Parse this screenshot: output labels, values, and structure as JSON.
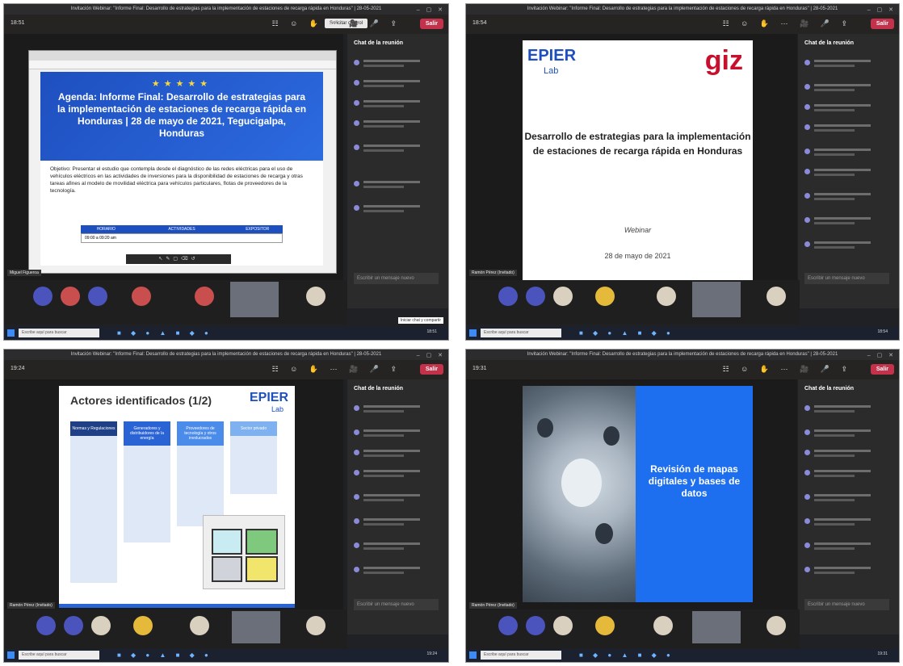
{
  "shots": [
    {
      "title": "Invitación Webinar: \"Informe Final: Desarrollo de estrategias para la implementación de estaciones de recarga rápida en Honduras\" | 28-05-2021",
      "time": "18:51",
      "share_label": "Solicitar control",
      "leave_label": "Salir",
      "chat_title": "Chat de la reunión",
      "chat_placeholder": "Escribir un mensaje nuevo",
      "presenter": "Miguel Figueroa",
      "tooltip": "Iniciar chat y compartir"
    },
    {
      "title": "Invitación Webinar: \"Informe Final: Desarrollo de estrategias para la implementación de estaciones de recarga rápida en Honduras\" | 28-05-2021",
      "time": "18:54",
      "leave_label": "Salir",
      "chat_title": "Chat de la reunión",
      "chat_placeholder": "Escribir un mensaje nuevo",
      "presenter": "Ramón Pérez (Invitado)"
    },
    {
      "title": "Invitación Webinar: \"Informe Final: Desarrollo de estrategias para la implementación de estaciones de recarga rápida en Honduras\" | 28-05-2021",
      "time": "19:24",
      "leave_label": "Salir",
      "chat_title": "Chat de la reunión",
      "chat_placeholder": "Escribir un mensaje nuevo",
      "presenter": "Ramón Pérez (Invitado)"
    },
    {
      "title": "Invitación Webinar: \"Informe Final: Desarrollo de estrategias para la implementación de estaciones de recarga rápida en Honduras\" | 28-05-2021",
      "time": "19:31",
      "leave_label": "Salir",
      "chat_title": "Chat de la reunión",
      "chat_placeholder": "Escribir un mensaje nuevo",
      "presenter": "Ramón Pérez (Invitado)"
    }
  ],
  "slide1": {
    "heading": "Agenda: Informe Final: Desarrollo de estrategias para la implementación de estaciones de recarga rápida en Honduras | 28 de mayo de 2021, Tegucigalpa, Honduras",
    "objective": "Objetivo: Presentar el estudio que contempla desde el diagnóstico de las redes eléctricas para el uso de vehículos eléctricos en las actividades de inversiones para la disponibilidad de estaciones de recarga y otras tareas afines al modelo de movilidad eléctrica para vehículos particulares, flotas de proveedores de la tecnología.",
    "table_headers": [
      "HORARIO",
      "ACTIVIDADES",
      "EXPOSITOR"
    ],
    "first_row": "09:00 a 09:20 am"
  },
  "slide2": {
    "left_logo": "EPIER",
    "left_sub": "Lab",
    "right_logo": "giz",
    "title": "Desarrollo de estrategias para la implementación de estaciones de recarga rápida en Honduras",
    "subtitle": "Webinar",
    "date": "28 de mayo de 2021"
  },
  "slide3": {
    "title": "Actores identificados (1/2)",
    "logo": "EPIER",
    "logo_sub": "Lab",
    "columns": [
      "Normas y Regulaciones",
      "Generadores y distribuidores de la energía",
      "Proveedores de tecnología y otros involucrados",
      "Sector privado"
    ]
  },
  "slide4": {
    "title": "Revisión de mapas digitales y bases de datos"
  },
  "taskbar": {
    "search": "Escribe aquí para buscar",
    "clock": "19:31"
  }
}
